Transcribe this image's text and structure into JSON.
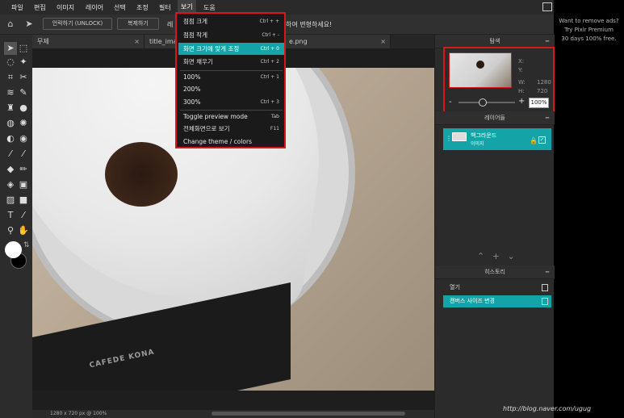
{
  "menubar": {
    "items": [
      "파일",
      "편집",
      "이미지",
      "레이어",
      "선택",
      "조정",
      "필터",
      "보기",
      "도움"
    ],
    "active": "보기"
  },
  "ad": {
    "line1": "Want to remove ads?",
    "line2": "Try Pixlr Premium",
    "line3": "30 days 100% free."
  },
  "optionsbar": {
    "unlock_label": "언락하기 (UNLOCK)",
    "duplicate_label": "복제하기",
    "hint_left": "레",
    "hint_right": "하여 변형하세요!"
  },
  "tabs": [
    {
      "label": "무제"
    },
    {
      "label": "title_imag"
    },
    {
      "label": "e.png"
    }
  ],
  "view_menu": {
    "items": [
      {
        "label": "점점 크게",
        "shortcut": "Ctrl + +"
      },
      {
        "label": "점점 작게",
        "shortcut": "Ctrl + -"
      },
      {
        "label": "화면 크기에 맞게 조정",
        "shortcut": "Ctrl + 0"
      },
      {
        "label": "화면 채우기",
        "shortcut": "Ctrl + 2"
      },
      {
        "label": "100%",
        "shortcut": "Ctrl + 1"
      },
      {
        "label": "200%",
        "shortcut": ""
      },
      {
        "label": "300%",
        "shortcut": "Ctrl + 3"
      },
      {
        "label": "Toggle preview mode",
        "shortcut": "Tab"
      },
      {
        "label": "전체화면으로 보기",
        "shortcut": "F11"
      },
      {
        "label": "Change theme / colors",
        "shortcut": ""
      }
    ],
    "highlighted": "화면 크기에 맞게 조정"
  },
  "navigator": {
    "title": "탐색",
    "x_label": "X:",
    "y_label": "Y:",
    "w_label": "W:",
    "w_value": "1280",
    "h_label": "H:",
    "h_value": "720",
    "zoom_minus": "-",
    "zoom_plus": "+",
    "zoom_value": "100%"
  },
  "layers": {
    "title": "레이어들",
    "items": [
      {
        "name": "백그라운드",
        "sub": "이미지"
      }
    ]
  },
  "history": {
    "title": "히스토리",
    "items": [
      {
        "label": "열기",
        "active": false
      },
      {
        "label": "캔버스 사이즈 변경",
        "active": true
      }
    ]
  },
  "statusbar": {
    "text": "1280 x 720 px @ 100%"
  },
  "canvas": {
    "scale_brand": "CAFEDE KONA"
  },
  "watermark": "http://blog.naver.com/ugug",
  "colors": {
    "accent": "#14a4a8",
    "highlight_border": "#d9161c",
    "foreground": "#ffffff",
    "background": "#000000"
  }
}
